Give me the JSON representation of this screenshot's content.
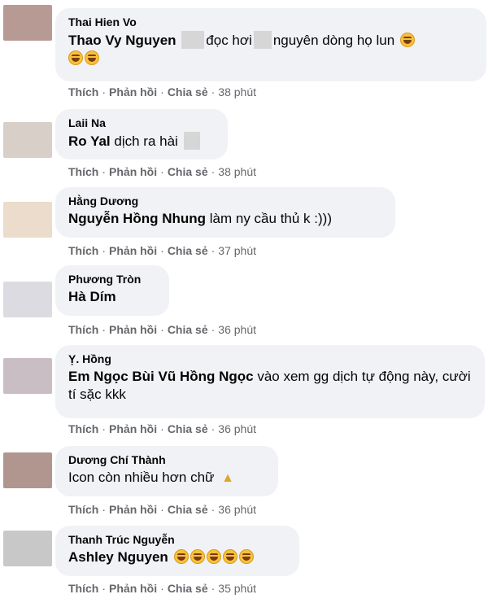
{
  "comments": [
    {
      "author": "Thai Hien Vo",
      "mention": "Thao Vy Nguyen",
      "text_a": "đọc hơi",
      "text_b": "nguyên dòng họ lun",
      "time": "38 phút",
      "avatar_color": "#b89a95"
    },
    {
      "author": "Laii Na",
      "mention": "Ro Yal",
      "text": "dịch ra hài",
      "time": "38 phút",
      "avatar_color": "#d8cfc9"
    },
    {
      "author": "Hằng Dương",
      "mention": "Nguyễn Hồng Nhung",
      "text": "làm ny cầu thủ k :)))",
      "time": "37 phút",
      "avatar_color": "#ecdccb"
    },
    {
      "author": "Phương Tròn",
      "mention": "Hà Dím",
      "time": "36 phút",
      "avatar_color": "#dcdbe2"
    },
    {
      "author": "Ỵ. Hồng",
      "mention": "Em Ngọc Bùi Vũ Hồng Ngọc",
      "text": "vào xem gg dịch tự động này, cười tí sặc kkk",
      "time": "36 phút",
      "avatar_color": "#c9bec3"
    },
    {
      "author": "Dương Chí Thành",
      "text": "Icon còn nhiều hơn chữ",
      "time": "36 phút",
      "avatar_color": "#b0968f"
    },
    {
      "author": "Thanh Trúc Nguyễn",
      "mention": "Ashley Nguyen",
      "time": "35 phút",
      "avatar_color": "#c8c8c8"
    }
  ],
  "actions": {
    "like": "Thích",
    "reply": "Phản hồi",
    "share": "Chia sẻ",
    "separator": "·"
  }
}
